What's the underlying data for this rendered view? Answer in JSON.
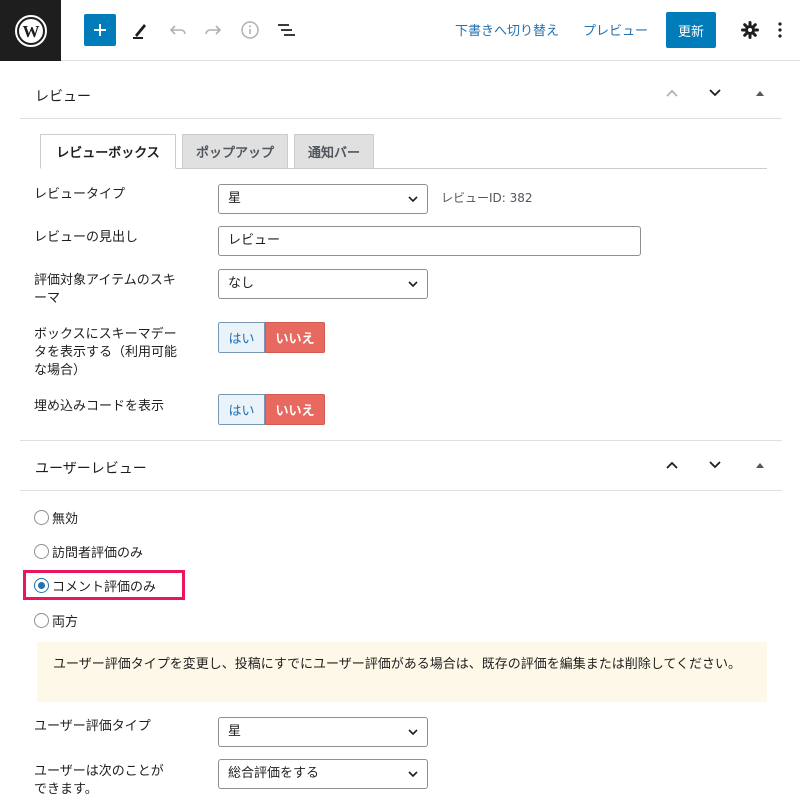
{
  "toolbar": {
    "switch_to_draft": "下書きへ切り替え",
    "preview": "プレビュー",
    "update": "更新"
  },
  "review_panel": {
    "title": "レビュー",
    "tabs": [
      "レビューボックス",
      "ポップアップ",
      "通知バー"
    ],
    "review_type_label": "レビュータイプ",
    "review_type_value": "星",
    "review_id": "レビューID: 382",
    "heading_label": "レビューの見出し",
    "heading_value": "レビュー",
    "schema_label": "評価対象アイテムのスキーマ",
    "schema_value": "なし",
    "show_schema_label": "ボックスにスキーマデータを表示する（利用可能な場合）",
    "show_embed_label": "埋め込みコードを表示",
    "yes": "はい",
    "no": "いいえ"
  },
  "user_review_panel": {
    "title": "ユーザーレビュー",
    "options": [
      "無効",
      "訪問者評価のみ",
      "コメント評価のみ",
      "両方"
    ],
    "selected_index": 2,
    "notice": "ユーザー評価タイプを変更し、投稿にすでにユーザー評価がある場合は、既存の評価を編集または削除してください。",
    "rating_type_label": "ユーザー評価タイプ",
    "rating_type_value": "星",
    "can_do_label": "ユーザーは次のことができます。",
    "can_do_value": "総合評価をする"
  },
  "colors": {
    "accent": "#007cba",
    "link": "#2271b1",
    "no_button": "#e8695f",
    "highlight": "#e8175d",
    "notice_bg": "#fdf8e7"
  }
}
